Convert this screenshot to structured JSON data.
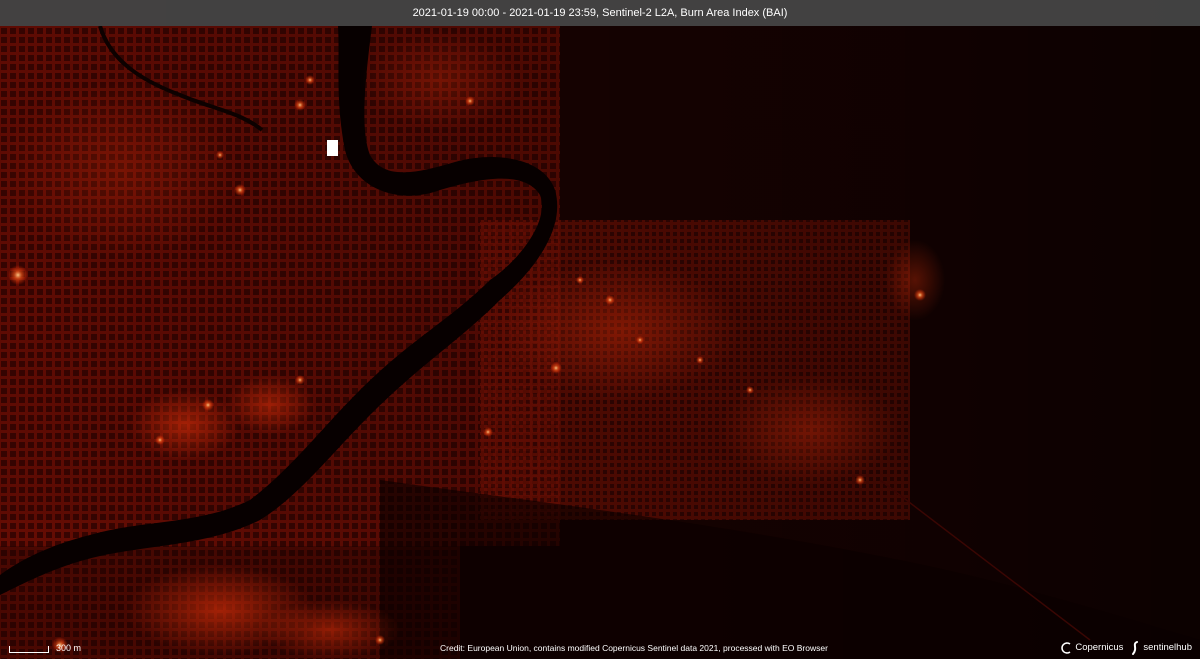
{
  "header": {
    "title": "2021-01-19 00:00 - 2021-01-19 23:59, Sentinel-2 L2A, Burn Area Index (BAI)"
  },
  "map": {
    "background_color": "#140101",
    "river_color": "#070000",
    "hotspot_color": "#ff3a0a",
    "bright_color": "#fff2dc"
  },
  "scale": {
    "label": "300 m"
  },
  "footer": {
    "credit": "Credit: European Union, contains modified Copernicus Sentinel data 2021, processed with EO Browser",
    "logo_copernicus": "Copernicus",
    "logo_sentinelhub": "sentinelhub"
  },
  "icons": {
    "copernicus": "copernicus-logo-icon",
    "sentinelhub": "sentinelhub-logo-icon"
  }
}
